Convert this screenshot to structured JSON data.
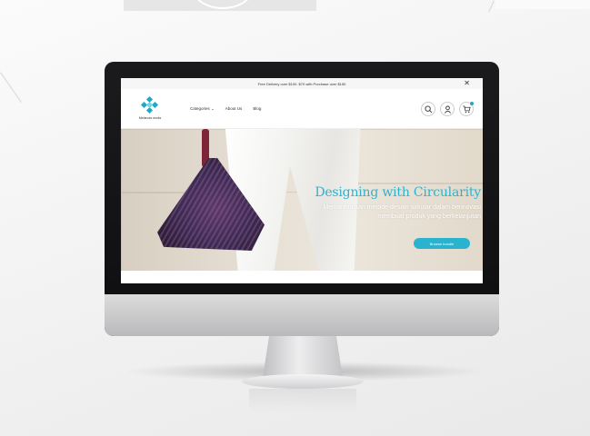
{
  "announcement": {
    "text": "Free Delivery over $100. $70 with Purchase over $150",
    "close_icon": "close-icon"
  },
  "nav": {
    "logo_name": "Metanoia works",
    "menu": [
      {
        "label": "Categories ⌄"
      },
      {
        "label": "About Us"
      },
      {
        "label": "Blog"
      }
    ],
    "icons": [
      "search-icon",
      "user-icon",
      "cart-icon"
    ]
  },
  "hero": {
    "title": "Designing with Circularity",
    "subtitle": "Memanfaatkan metode desain sirkular dalam berinovasi membuat produk yang berkelanjutan",
    "button_label": "Browse bundle"
  },
  "colors": {
    "accent": "#2ab3cf",
    "bag": "#3c2c55",
    "strap": "#7d2438"
  }
}
